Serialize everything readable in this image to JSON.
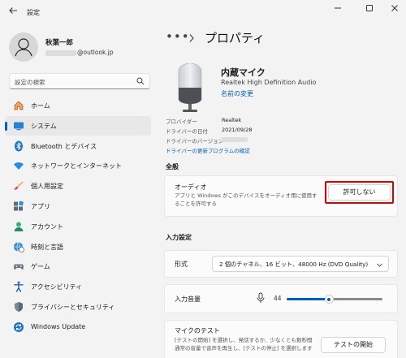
{
  "window": {
    "title": "設定",
    "back_icon": "back-arrow-icon",
    "controls": [
      "minimize-icon",
      "maximize-icon",
      "close-icon"
    ]
  },
  "user": {
    "name": "秋葉一郎",
    "email_suffix": "@outlook.jp"
  },
  "search": {
    "placeholder": "設定の検索"
  },
  "nav": {
    "items": [
      {
        "label": "ホーム",
        "icon": "home-icon",
        "active": false
      },
      {
        "label": "システム",
        "icon": "system-icon",
        "active": true
      },
      {
        "label": "Bluetooth とデバイス",
        "icon": "bluetooth-icon",
        "active": false
      },
      {
        "label": "ネットワークとインターネット",
        "icon": "wifi-icon",
        "active": false
      },
      {
        "label": "個人用設定",
        "icon": "brush-icon",
        "active": false
      },
      {
        "label": "アプリ",
        "icon": "apps-icon",
        "active": false
      },
      {
        "label": "アカウント",
        "icon": "account-icon",
        "active": false
      },
      {
        "label": "時刻と言語",
        "icon": "globe-clock-icon",
        "active": false
      },
      {
        "label": "ゲーム",
        "icon": "gamepad-icon",
        "active": false
      },
      {
        "label": "アクセシビリティ",
        "icon": "accessibility-icon",
        "active": false
      },
      {
        "label": "プライバシーとセキュリティ",
        "icon": "shield-icon",
        "active": false
      },
      {
        "label": "Windows Update",
        "icon": "update-icon",
        "active": false
      }
    ]
  },
  "breadcrumb": {
    "ellipsis": "•••",
    "separator": ">",
    "title": "プロパティ"
  },
  "device": {
    "name": "内蔵マイク",
    "subtitle": "Realtek High Definition Audio",
    "rename_link": "名前の変更",
    "properties": [
      {
        "label": "プロバイダー",
        "value": "Realtek"
      },
      {
        "label": "ドライバーの日付",
        "value": "2021/09/28"
      },
      {
        "label": "ドライバーのバージョン",
        "value": ""
      }
    ],
    "driver_update_link": "ドライバーの更新プログラムの確認"
  },
  "general": {
    "section_title": "全般",
    "audio": {
      "title": "オーディオ",
      "description": "アプリと Windows がこのデバイスをオーディオ用に使用することを許可する",
      "button_label": "許可しない",
      "highlight_color": "#e00000"
    }
  },
  "input_settings": {
    "section_title": "入力設定",
    "format": {
      "label": "形式",
      "selected": "2 個のチャネル、16 ビット、48000 Hz (DVD Quality)"
    },
    "volume": {
      "label": "入力音量",
      "value": "44",
      "level_percent": 44
    },
    "mic_test": {
      "title": "マイクのテスト",
      "description": "[テストの開始] を選択し、発話するか、少なくとも数秒間通常の音量で音声を再生し、[テストの停止] を選択します",
      "button_label": "テストの開始"
    }
  },
  "colors": {
    "accent": "#005fb8",
    "background": "#f3f3f3",
    "card": "#fbfbfb"
  }
}
